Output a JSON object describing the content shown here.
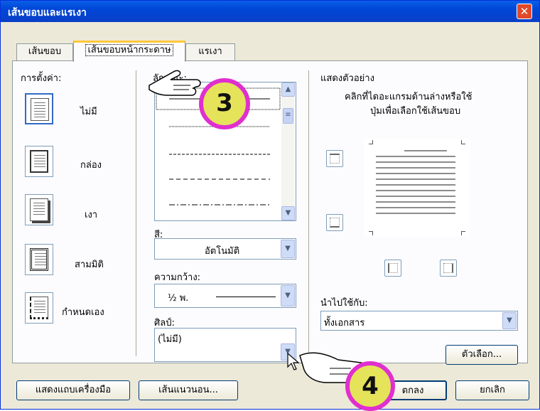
{
  "dialog": {
    "title": "เส้นขอบและแรเงา",
    "close": "✕"
  },
  "tabs": [
    {
      "label": "เส้นขอบ"
    },
    {
      "label": "เส้นขอบหน้ากระดาษ"
    },
    {
      "label": "แรเงา"
    }
  ],
  "settings": {
    "heading": "การตั้งค่า:",
    "items": [
      {
        "label": "ไม่มี"
      },
      {
        "label": "กล่อง"
      },
      {
        "label": "เงา"
      },
      {
        "label": "สามมิติ"
      },
      {
        "label": "กำหนดเอง"
      }
    ]
  },
  "style": {
    "heading": "ลักษณะ:"
  },
  "color": {
    "label": "สี:",
    "value": "อัตโนมัติ"
  },
  "width": {
    "label": "ความกว้าง:",
    "value": "½ พ."
  },
  "art": {
    "label": "ศิลป์:",
    "value": "(ไม่มี)"
  },
  "preview": {
    "heading": "แสดงตัวอย่าง",
    "hint_line1": "คลิกที่ไดอะแกรมด้านล่างหรือใช้",
    "hint_line2": "ปุ่มเพื่อเลือกใช้เส้นขอบ"
  },
  "apply_to": {
    "label": "นำไปใช้กับ:",
    "value": "ทั้งเอกสาร"
  },
  "buttons": {
    "options": "ตัวเลือก...",
    "show_toolbar": "แสดงแถบเครื่องมือ",
    "horizontal_line": "เส้นแนวนอน...",
    "ok": "ตกลง",
    "cancel": "ยกเลิก"
  },
  "callouts": {
    "first": "3",
    "second": "4"
  },
  "colors": {
    "title_bar": "#0054e3",
    "badge_fill": "#e5e35a",
    "badge_ring": "#e02fcf"
  }
}
